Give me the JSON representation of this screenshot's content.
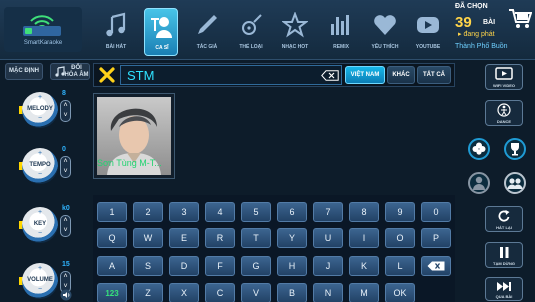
{
  "app": {
    "logo_text": "SmartKaraoke"
  },
  "nav": {
    "tabs": [
      {
        "label": "BÀI HÁT",
        "icon": "music-note-icon",
        "active": false
      },
      {
        "label": "CA SĨ",
        "icon": "singer-icon",
        "active": true
      },
      {
        "label": "TÁC GIẢ",
        "icon": "pen-icon",
        "active": false
      },
      {
        "label": "THỂ LOẠI",
        "icon": "guitar-icon",
        "active": false
      },
      {
        "label": "NHẠC HOT",
        "icon": "star-icon",
        "active": false
      },
      {
        "label": "REMIX",
        "icon": "equalizer-icon",
        "active": false
      },
      {
        "label": "YÊU THÍCH",
        "icon": "heart-icon",
        "active": false
      },
      {
        "label": "YOUTUBE",
        "icon": "youtube-icon",
        "active": false
      }
    ]
  },
  "queue": {
    "title": "ĐÃ CHỌN",
    "count": "39",
    "unit": "BÀI",
    "status": "▸ đang phát",
    "now_playing": "Thành Phố Buồn"
  },
  "left_panel": {
    "default_label": "MẶC ĐỊNH",
    "mix_label_1": "ĐỔI",
    "mix_label_2": "HÒA ÂM",
    "knobs": [
      {
        "label": "MELODY",
        "value": "8",
        "plus": "+",
        "minus": "−"
      },
      {
        "label": "TEMPO",
        "value": "0",
        "plus": "+",
        "minus": "−"
      },
      {
        "label": "KEY",
        "value": "k0",
        "plus": "+",
        "minus": "−"
      },
      {
        "label": "VOLUME",
        "value": "15",
        "plus": "+",
        "minus": "−"
      }
    ]
  },
  "search": {
    "query": "STM",
    "filters": {
      "vn": "VIỆT NAM",
      "other": "KHÁC",
      "all": "TẤT CẢ"
    }
  },
  "results": [
    {
      "name": "Sơn Tùng M-T..."
    }
  ],
  "keyboard": {
    "row1": [
      "1",
      "2",
      "3",
      "4",
      "5",
      "6",
      "7",
      "8",
      "9",
      "0"
    ],
    "row2": [
      "Q",
      "W",
      "E",
      "R",
      "T",
      "Y",
      "U",
      "I",
      "O",
      "P"
    ],
    "row3": [
      "A",
      "S",
      "D",
      "F",
      "G",
      "H",
      "J",
      "K",
      "L"
    ],
    "row4": [
      "123",
      "Z",
      "X",
      "C",
      "V",
      "B",
      "N",
      "M",
      "OK"
    ]
  },
  "right_panel": {
    "video_label": "WIFI VIDEO",
    "dance_label": "DANCE",
    "replay_label": "HÁT LẠI",
    "pause_label": "TẠM DỪNG",
    "next_label": "QUA BÀI"
  },
  "colors": {
    "accent": "#1a9fd8",
    "highlight_green": "#20d470",
    "count_yellow": "#ffd54a",
    "search_text": "#2fe2ff"
  }
}
